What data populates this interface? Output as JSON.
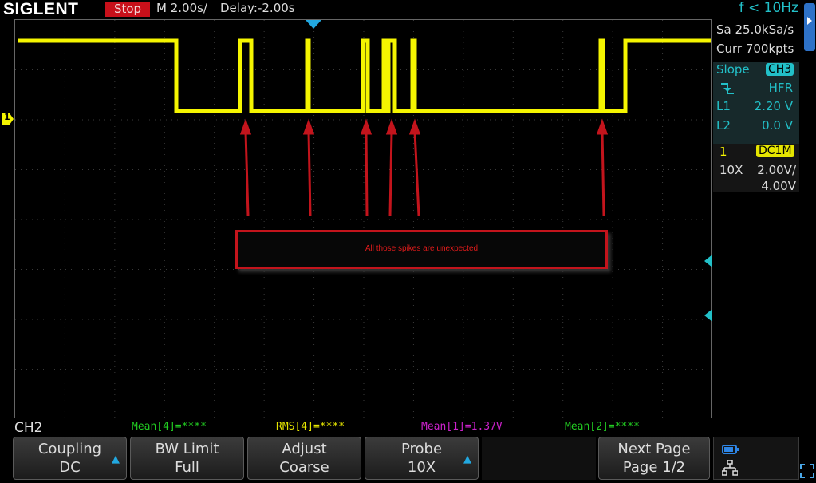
{
  "topbar": {
    "brand": "SIGLENT",
    "run_state": "Stop",
    "timebase": "M 2.00s/",
    "delay": "Delay:-2.00s",
    "trigger_freq": "f < 10Hz"
  },
  "acquisition": {
    "sample_rate": "Sa 25.0kSa/s",
    "memory_depth": "Curr 700kpts"
  },
  "trigger": {
    "type_label": "Slope",
    "source": "CH3",
    "edge_icon": "falling-edge-icon",
    "coupling": "HFR",
    "l1_label": "L1",
    "l1_value": "2.20 V",
    "l2_label": "L2",
    "l2_value": "0.0 V"
  },
  "channel1": {
    "number": "1",
    "coupling_badge": "DC1M",
    "probe": "10X",
    "scale": "2.00V/",
    "offset": "4.00V"
  },
  "annotation": {
    "text": "All those spikes are unexpected"
  },
  "markers": {
    "ch1_ground": "1"
  },
  "active_channel": "CH2",
  "measurements": [
    {
      "text": "Mean[4]=****",
      "color": "#22cc22"
    },
    {
      "text": "RMS[4]=****",
      "color": "#22cc22"
    },
    {
      "text": "Mean[1]=1.37V",
      "color": "#e6e600"
    },
    {
      "text": "Mean[2]=****",
      "color": "#cc22cc"
    }
  ],
  "softkeys": {
    "coupling": {
      "line1": "Coupling",
      "line2": "DC"
    },
    "bw_limit": {
      "line1": "BW Limit",
      "line2": "Full"
    },
    "adjust": {
      "line1": "Adjust",
      "line2": "Coarse"
    },
    "probe": {
      "line1": "Probe",
      "line2": "10X"
    },
    "next_page": {
      "line1": "Next Page",
      "line2": "Page 1/2"
    }
  },
  "colors": {
    "ch1": "#f5f500",
    "accent": "#22c0c8",
    "alert": "#c8101a"
  }
}
